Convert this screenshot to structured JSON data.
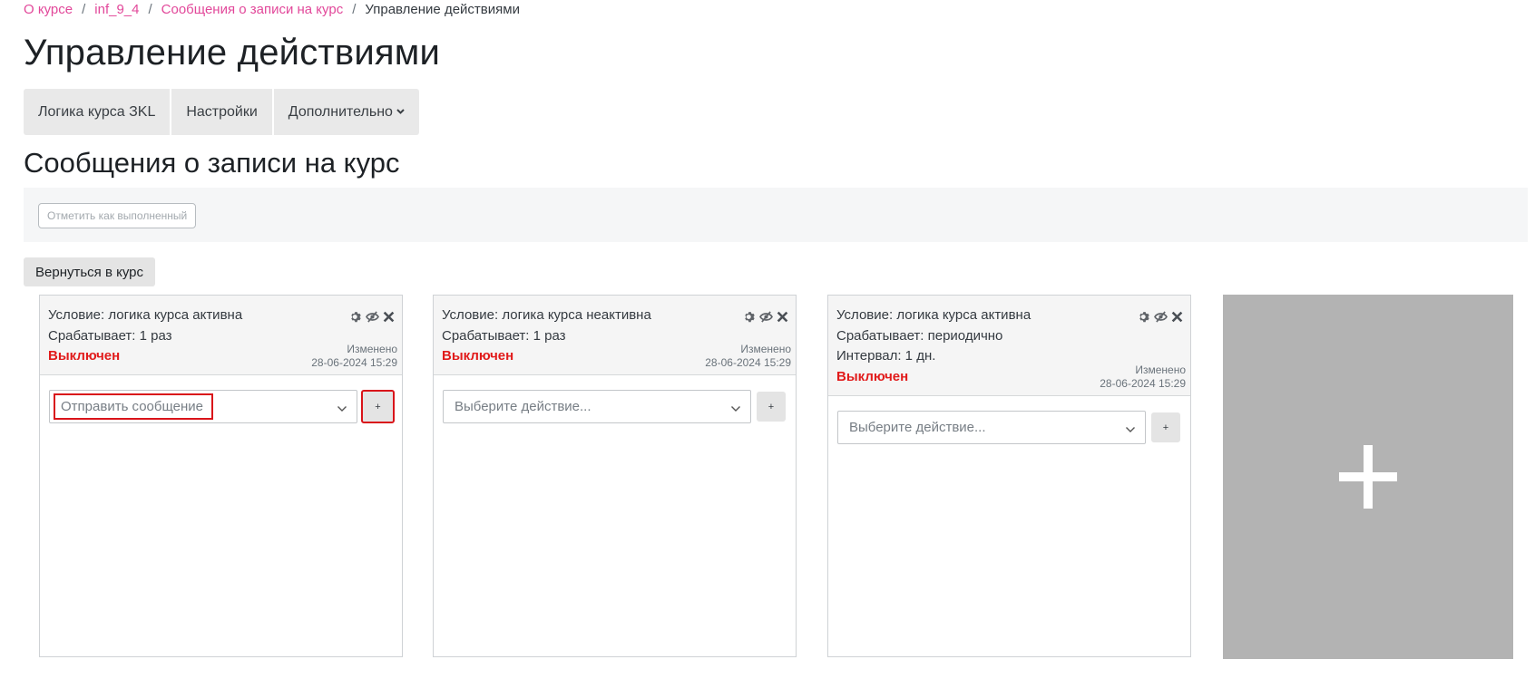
{
  "breadcrumb": {
    "items": [
      {
        "label": "О курсе",
        "link": true
      },
      {
        "label": "inf_9_4",
        "link": true
      },
      {
        "label": "Сообщения о записи на курс",
        "link": true
      },
      {
        "label": "Управление действиями",
        "link": false
      }
    ],
    "separator": "/"
  },
  "page_title": "Управление действиями",
  "tabs": [
    {
      "label": "Логика курса ЗKL"
    },
    {
      "label": "Настройки"
    },
    {
      "label": "Дополнительно"
    }
  ],
  "section_title": "Сообщения о записи на курс",
  "mark_done_label": "Отметить как выполненный",
  "back_button_label": "Вернуться в курс",
  "cards": [
    {
      "condition": "Условие: логика курса активна",
      "trigger": "Срабатывает: 1 раз",
      "status": "Выключен",
      "modified_label": "Изменено",
      "modified_date": "28-06-2024 15:29",
      "action_value": "Отправить сообщение",
      "add_label": "+"
    },
    {
      "condition": "Условие: логика курса неактивна",
      "trigger": "Срабатывает: 1 раз",
      "status": "Выключен",
      "modified_label": "Изменено",
      "modified_date": "28-06-2024 15:29",
      "action_value": "Выберите действие...",
      "add_label": "+"
    },
    {
      "condition": "Условие: логика курса активна",
      "trigger": "Срабатывает: периодично",
      "interval": "Интервал: 1 дн.",
      "status": "Выключен",
      "modified_label": "Изменено",
      "modified_date": "28-06-2024 15:29",
      "action_value": "Выберите действие...",
      "add_label": "+"
    }
  ],
  "colors": {
    "link": "#e2489a",
    "status_off": "#e11b1b",
    "highlight": "#d9141a",
    "new_card_bg": "#b3b3b3"
  }
}
